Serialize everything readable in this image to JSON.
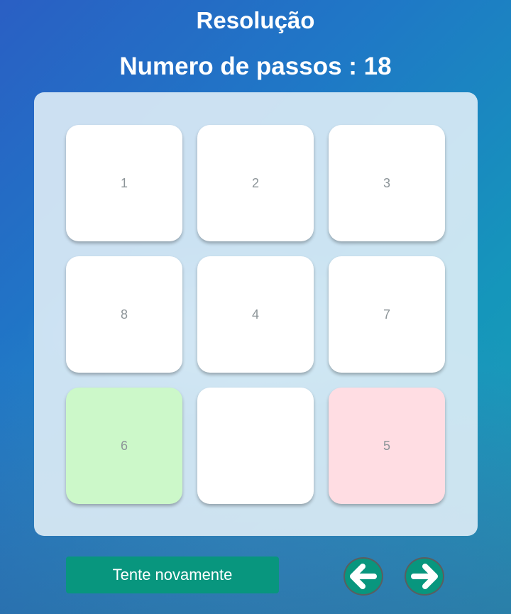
{
  "title": "Resolução",
  "steps_label": "Numero de passos : 18",
  "board": {
    "tiles": [
      "1",
      "2",
      "3",
      "8",
      "4",
      "7",
      "6",
      "",
      "5"
    ],
    "highlight": {
      "green_tile": "6",
      "pink_tile": "5"
    },
    "colors": {
      "tile": "#ffffff",
      "green": "#ccf8c9",
      "pink": "#ffdde3"
    }
  },
  "controls": {
    "retry_label": "Tente novamente",
    "prev_icon": "arrow-left-icon",
    "next_icon": "arrow-right-icon",
    "accent": "#08967e"
  }
}
